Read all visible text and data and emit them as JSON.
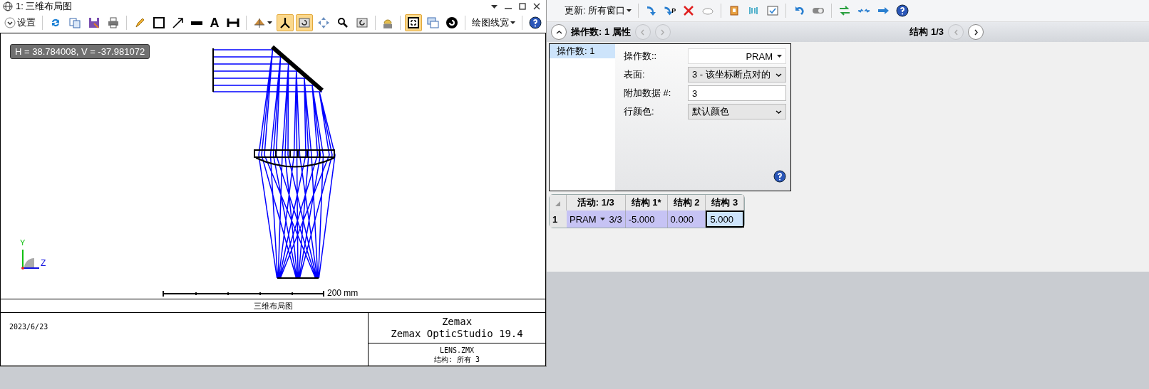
{
  "layout_window": {
    "title": "1: 三维布局图",
    "toolbar": [
      {
        "kind": "button",
        "label": "设置"
      },
      {
        "kind": "separator"
      },
      {
        "kind": "tool",
        "selected": false
      },
      {
        "kind": "tool",
        "selected": false
      },
      {
        "kind": "tool",
        "selected": false
      },
      {
        "kind": "tool",
        "selected": false
      },
      {
        "kind": "separator"
      },
      {
        "kind": "tool",
        "selected": false
      },
      {
        "kind": "tool",
        "selected": false
      },
      {
        "kind": "tool",
        "selected": false
      },
      {
        "kind": "tool",
        "selected": false
      },
      {
        "kind": "letter",
        "label": "A",
        "selected": false
      },
      {
        "kind": "tool",
        "selected": false
      },
      {
        "kind": "separator"
      },
      {
        "kind": "menu_tool",
        "selected": false
      },
      {
        "kind": "tool",
        "selected": true
      },
      {
        "kind": "tool",
        "selected": true
      },
      {
        "kind": "tool",
        "selected": false
      },
      {
        "kind": "tool",
        "selected": false
      },
      {
        "kind": "tool",
        "selected": false
      },
      {
        "kind": "separator"
      },
      {
        "kind": "tool",
        "selected": false
      },
      {
        "kind": "separator"
      },
      {
        "kind": "tool",
        "selected": true
      },
      {
        "kind": "tool",
        "selected": false
      },
      {
        "kind": "tool",
        "selected": false
      },
      {
        "kind": "separator"
      },
      {
        "kind": "button",
        "label": "绘图线宽"
      },
      {
        "kind": "separator"
      },
      {
        "kind": "tool",
        "selected": false
      }
    ],
    "cursor_readout": "H = 38.784008, V = -37.981072",
    "axes": {
      "y": "Y",
      "z": "Z"
    },
    "scale_label": "200 mm",
    "footer": {
      "title": "三维布局图",
      "date": "2023/6/23",
      "company": "Zemax",
      "product": "Zemax OpticStudio 19.4",
      "file": "LENS.ZMX",
      "configuration": "结构: 所有 3"
    }
  },
  "editor": {
    "toolbar": [
      {
        "kind": "button",
        "label": "更新: 所有窗口"
      },
      {
        "kind": "separator"
      },
      {
        "kind": "tool"
      },
      {
        "kind": "tool_p",
        "label": "P"
      },
      {
        "kind": "tool"
      },
      {
        "kind": "tool"
      },
      {
        "kind": "separator"
      },
      {
        "kind": "tool"
      },
      {
        "kind": "tool"
      },
      {
        "kind": "tool"
      },
      {
        "kind": "separator"
      },
      {
        "kind": "tool"
      },
      {
        "kind": "tool"
      },
      {
        "kind": "separator"
      },
      {
        "kind": "tool"
      },
      {
        "kind": "tool"
      },
      {
        "kind": "tool"
      },
      {
        "kind": "tool"
      }
    ],
    "header": {
      "expanded": true,
      "title": "操作数: 1 属性",
      "prev_disabled": true,
      "next_disabled": true,
      "config": "结构 1/3",
      "config_prev_disabled": true,
      "config_next_disabled": false
    },
    "operands": [
      {
        "label": "操作数: 1",
        "selected": true
      }
    ],
    "properties": [
      {
        "kind": "select_right",
        "label": "操作数::",
        "value": "PRAM"
      },
      {
        "kind": "select",
        "label": "表面:",
        "value": "3 - 该坐标断点对的"
      },
      {
        "kind": "input",
        "label": "附加数据 #:",
        "value": "3"
      },
      {
        "kind": "select",
        "label": "行颜色:",
        "value": "默认颜色"
      }
    ],
    "table": {
      "columns": [
        "活动: 1/3",
        "结构 1*",
        "结构 2",
        "结构 3"
      ],
      "rows": [
        {
          "number": "1",
          "cells": [
            {
              "kind": "operand",
              "operand": "PRAM",
              "surface": "3/3",
              "selected": false
            },
            {
              "kind": "value",
              "text": "-5.000",
              "selected": false
            },
            {
              "kind": "value",
              "text": "0.000",
              "selected": false
            },
            {
              "kind": "value",
              "text": "5.000",
              "selected": true
            }
          ]
        }
      ]
    }
  }
}
